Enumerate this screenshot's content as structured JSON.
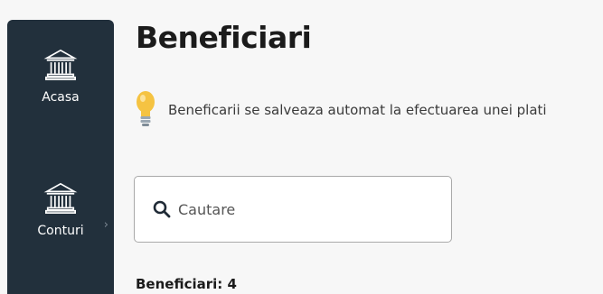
{
  "sidebar": {
    "items": [
      {
        "label": "Acasa",
        "icon": "bank-icon"
      },
      {
        "label": "Conturi",
        "icon": "bank-icon",
        "chevron": "›"
      }
    ]
  },
  "main": {
    "title": "Beneficiari",
    "tip": {
      "icon": "lightbulb-icon",
      "text": "Beneficarii se salveaza automat la efectuarea unei plati"
    },
    "search": {
      "placeholder": "Cautare",
      "value": ""
    },
    "count_label": "Beneficiari: 4"
  },
  "colors": {
    "sidebar_bg": "#22303c",
    "page_bg": "#f7f7f7",
    "bulb": "#f5c342"
  }
}
